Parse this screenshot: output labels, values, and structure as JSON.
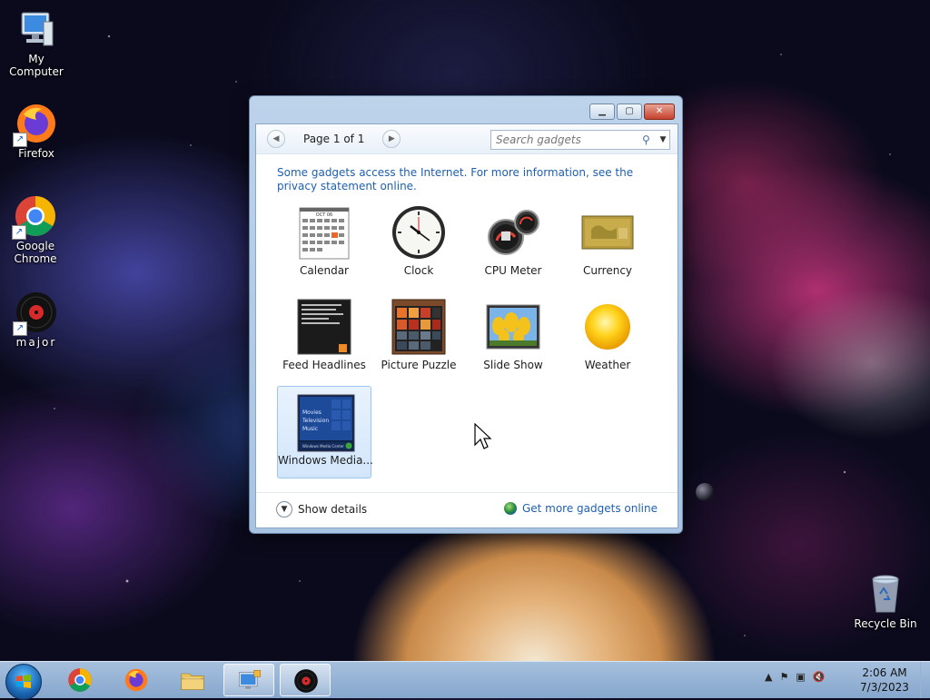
{
  "desktop": {
    "icons": [
      {
        "label": "My Computer",
        "icon": "computer-icon"
      },
      {
        "label": "Firefox",
        "icon": "firefox-icon"
      },
      {
        "label": "Google Chrome",
        "icon": "chrome-icon"
      },
      {
        "label": "major",
        "icon": "vinyl-record-icon"
      },
      {
        "label": "Recycle Bin",
        "icon": "recycle-bin-icon"
      }
    ]
  },
  "window": {
    "pager": {
      "text": "Page 1 of 1",
      "prev": "◀",
      "next": "▶"
    },
    "search": {
      "placeholder": "Search gadgets"
    },
    "info_text": "Some gadgets access the Internet.  For more information, see the privacy statement online.",
    "gadgets": [
      {
        "label": "Calendar",
        "icon": "calendar-icon",
        "cal_month": "OCT 06"
      },
      {
        "label": "Clock",
        "icon": "clock-icon"
      },
      {
        "label": "CPU Meter",
        "icon": "cpu-meter-icon"
      },
      {
        "label": "Currency",
        "icon": "currency-icon"
      },
      {
        "label": "Feed Headlines",
        "icon": "feed-headlines-icon"
      },
      {
        "label": "Picture Puzzle",
        "icon": "picture-puzzle-icon"
      },
      {
        "label": "Slide Show",
        "icon": "slide-show-icon"
      },
      {
        "label": "Weather",
        "icon": "weather-icon"
      },
      {
        "label": "Windows Media...",
        "icon": "windows-media-center-icon",
        "thumb_lines": [
          "Movies",
          "Television",
          "Music"
        ],
        "thumb_footer": "Windows Media Center"
      }
    ],
    "footer": {
      "show_details": "Show details",
      "more_online": "Get more gadgets online"
    }
  },
  "taskbar": {
    "apps": [
      "chrome-icon",
      "firefox-icon",
      "file-explorer-icon",
      "gadgets-icon",
      "vinyl-record-icon"
    ],
    "clock": {
      "time": "2:06 AM",
      "date": "7/3/2023"
    }
  },
  "colors": {
    "accent": "#1f5fb0",
    "selection": "#d2e6fb"
  }
}
